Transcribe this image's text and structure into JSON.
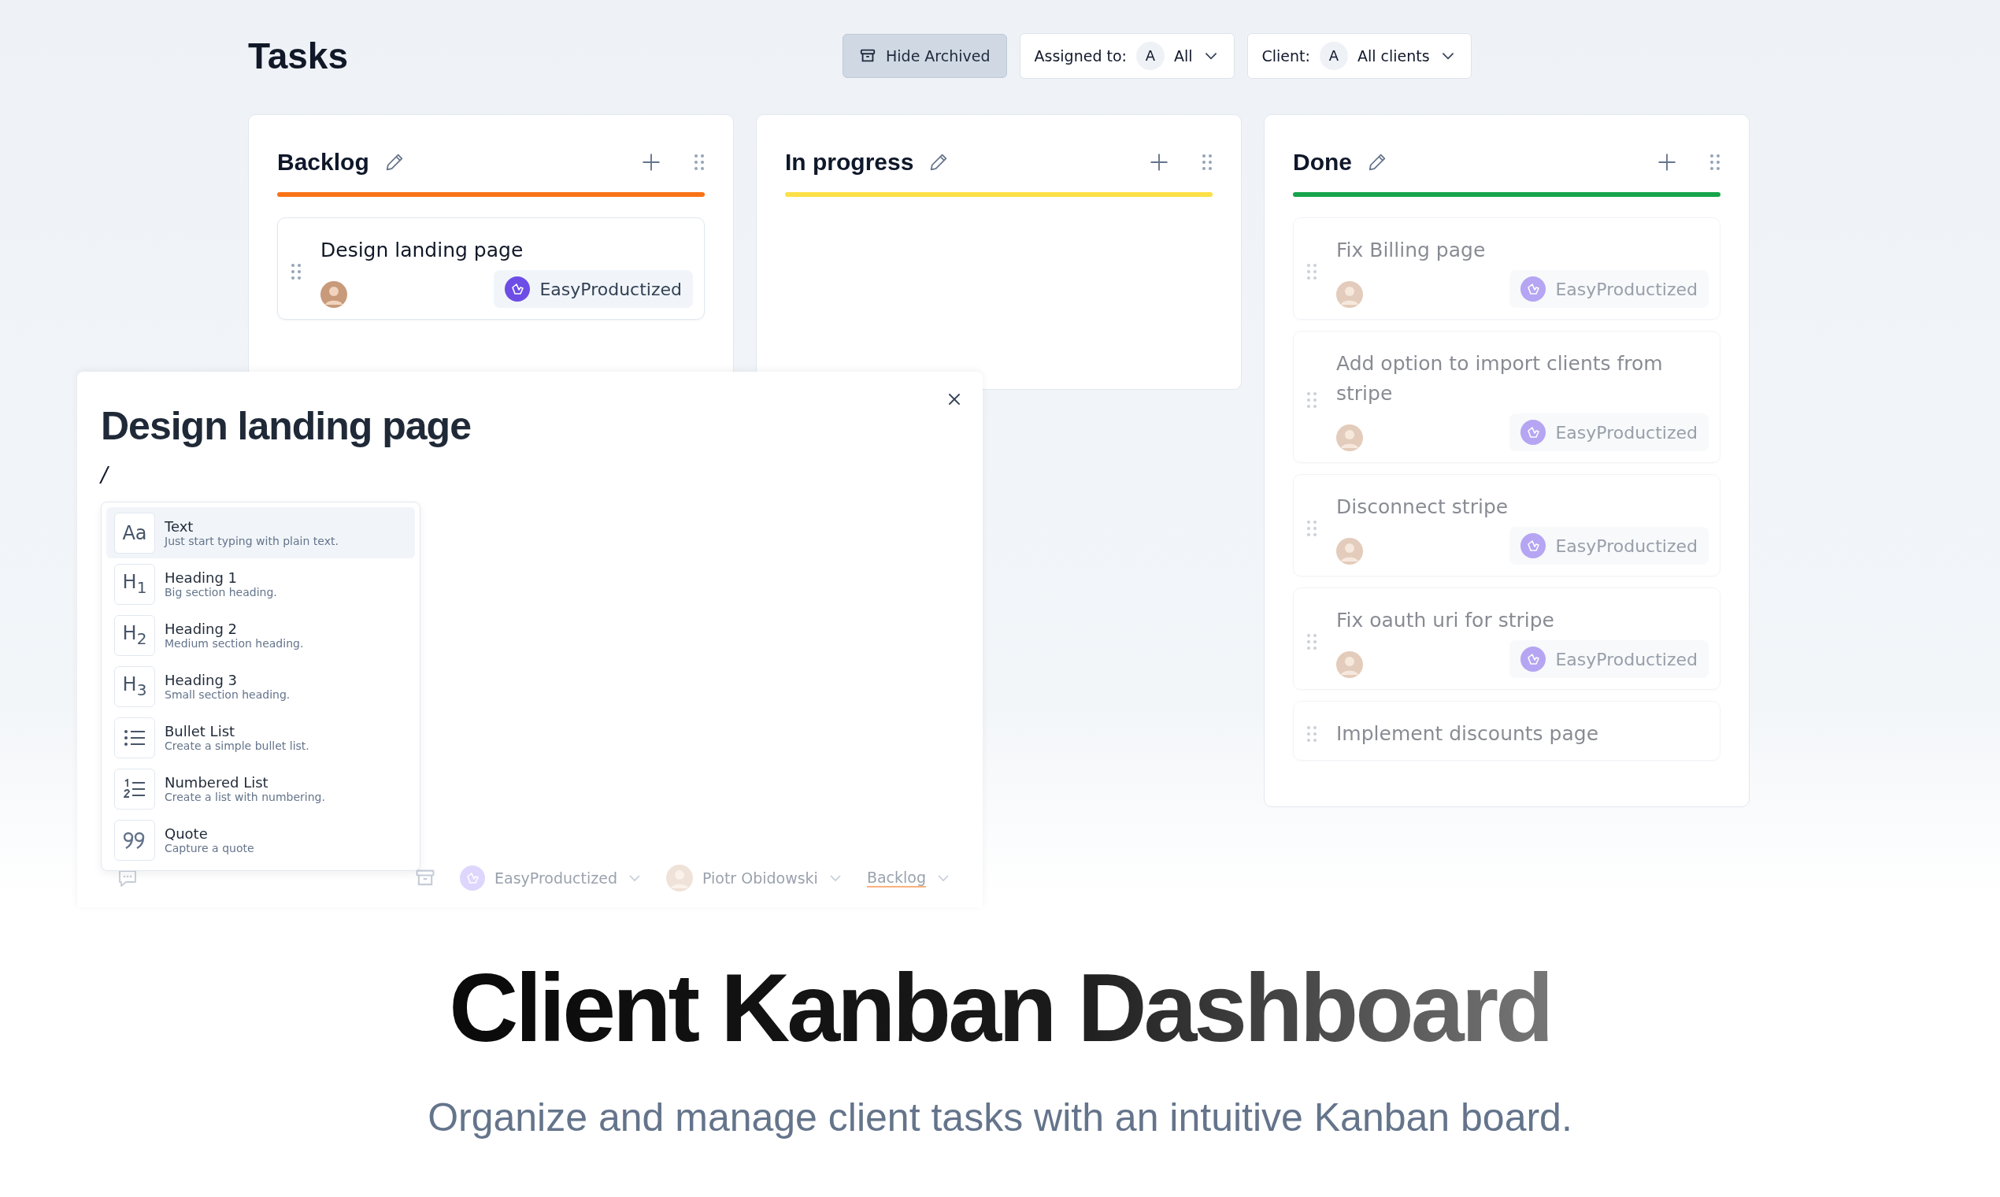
{
  "page": {
    "title": "Tasks"
  },
  "toolbar": {
    "hide_archived": {
      "label": "Hide Archived",
      "active": true
    },
    "filters": [
      {
        "label": "Assigned to:",
        "avatar": "A",
        "value": "All"
      },
      {
        "label": "Client:",
        "avatar": "A",
        "value": "All clients"
      }
    ]
  },
  "columns": [
    {
      "title": "Backlog",
      "color": "#f97316",
      "cards": [
        {
          "title": "Design landing page",
          "client": "EasyProductized",
          "faded": false
        }
      ]
    },
    {
      "title": "In progress",
      "color": "#fde047"
    },
    {
      "title": "Done",
      "color": "#16a34a",
      "cards": [
        {
          "title": "Fix Billing page",
          "client": "EasyProductized",
          "faded": true
        },
        {
          "title": "Add option to import clients from stripe",
          "client": "EasyProductized",
          "faded": true
        },
        {
          "title": "Disconnect stripe",
          "client": "EasyProductized",
          "faded": true
        },
        {
          "title": "Fix oauth uri for stripe",
          "client": "EasyProductized",
          "faded": true
        },
        {
          "title": "Implement discounts page",
          "faded": true
        }
      ]
    }
  ],
  "task_modal": {
    "title": "Design landing page",
    "editor_text": "/",
    "commands": [
      {
        "kind": "text",
        "icon_text": "Aa",
        "title": "Text",
        "description": "Just start typing with plain text.",
        "selected": true
      },
      {
        "kind": "heading",
        "icon_text": "H$_{1}$",
        "title": "Heading 1",
        "description": "Big section heading.",
        "selected": false
      },
      {
        "kind": "heading",
        "icon_text": "H$_{2}$",
        "title": "Heading 2",
        "description": "Medium section heading.",
        "selected": false
      },
      {
        "kind": "heading",
        "icon_text": "H$_{3}$",
        "title": "Heading 3",
        "description": "Small section heading.",
        "selected": false
      },
      {
        "kind": "bullet",
        "title": "Bullet List",
        "description": "Create a simple bullet list.",
        "selected": false
      },
      {
        "kind": "numbered",
        "title": "Numbered List",
        "description": "Create a list with numbering.",
        "selected": false
      },
      {
        "kind": "quote",
        "title": "Quote",
        "description": "Capture a quote",
        "selected": false
      }
    ],
    "footer": {
      "client": "EasyProductized",
      "assignee": "Piotr Obidowski",
      "status": "Backlog"
    }
  },
  "hero": {
    "headline": "Client Kanban Dashboard",
    "subtitle": "Organize and manage client tasks with an intuitive Kanban board."
  }
}
